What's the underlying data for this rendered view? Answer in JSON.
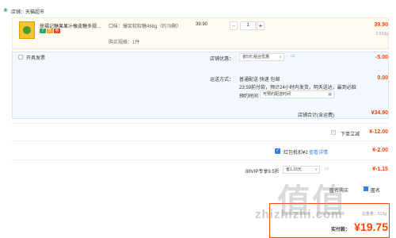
{
  "shop": {
    "icon": "shop-icon",
    "label": "店铺：天猫超市"
  },
  "item": {
    "title": "徐福记糖果果汁橡皮糖多规格散...",
    "tags": [
      "7",
      "优",
      "券"
    ],
    "sku_line1": "口味：爆浆软软糖468g（约78颗）",
    "sku_line2": "购买规格：1件",
    "unit_price": "39.90",
    "quantity": "1",
    "qty_minus": "−",
    "qty_plus": "+",
    "subtotal": "39.90",
    "weight": "0.513g"
  },
  "options": {
    "invoice_label": "开具发票",
    "shop_promo_label": "店铺优惠：",
    "shop_promo_select": "省5元:组合优惠",
    "shop_promo_amount": "-5.00",
    "shipping_label": "运送方式：",
    "shipping_line1": "普通配送 快递 包邮",
    "shipping_line2": "23:59前付款，预计24小时内发货，明天送达，最到必赔",
    "shipping_amount": "0.00",
    "appointment_label": "预约时间",
    "appointment_value": "可预约配送时间",
    "shop_total_label": "店铺合计(含运费)",
    "shop_total": "¥34.90"
  },
  "discounts": {
    "instant_label": "下单立减",
    "instant_amount": "¥-12.00",
    "redpacket_label": "红包抵扣¥2",
    "redpacket_link": "查看详情",
    "redpacket_amount": "¥-2.00",
    "vip_label": "88VIP专享9.5折",
    "vip_select": "省1.15元",
    "vip_amount": "¥-1.15"
  },
  "payment": {
    "anon_label": "匿名购买",
    "anon_text": "匿名",
    "weight": "总重量：513g",
    "label": "实付款：",
    "amount": "¥19.75"
  },
  "watermark": {
    "logo": "值值",
    "text": "zhizhizhi.com"
  },
  "colors": {
    "accent": "#ff4400",
    "link": "#3d7be6",
    "panel": "#f3f8fe"
  }
}
